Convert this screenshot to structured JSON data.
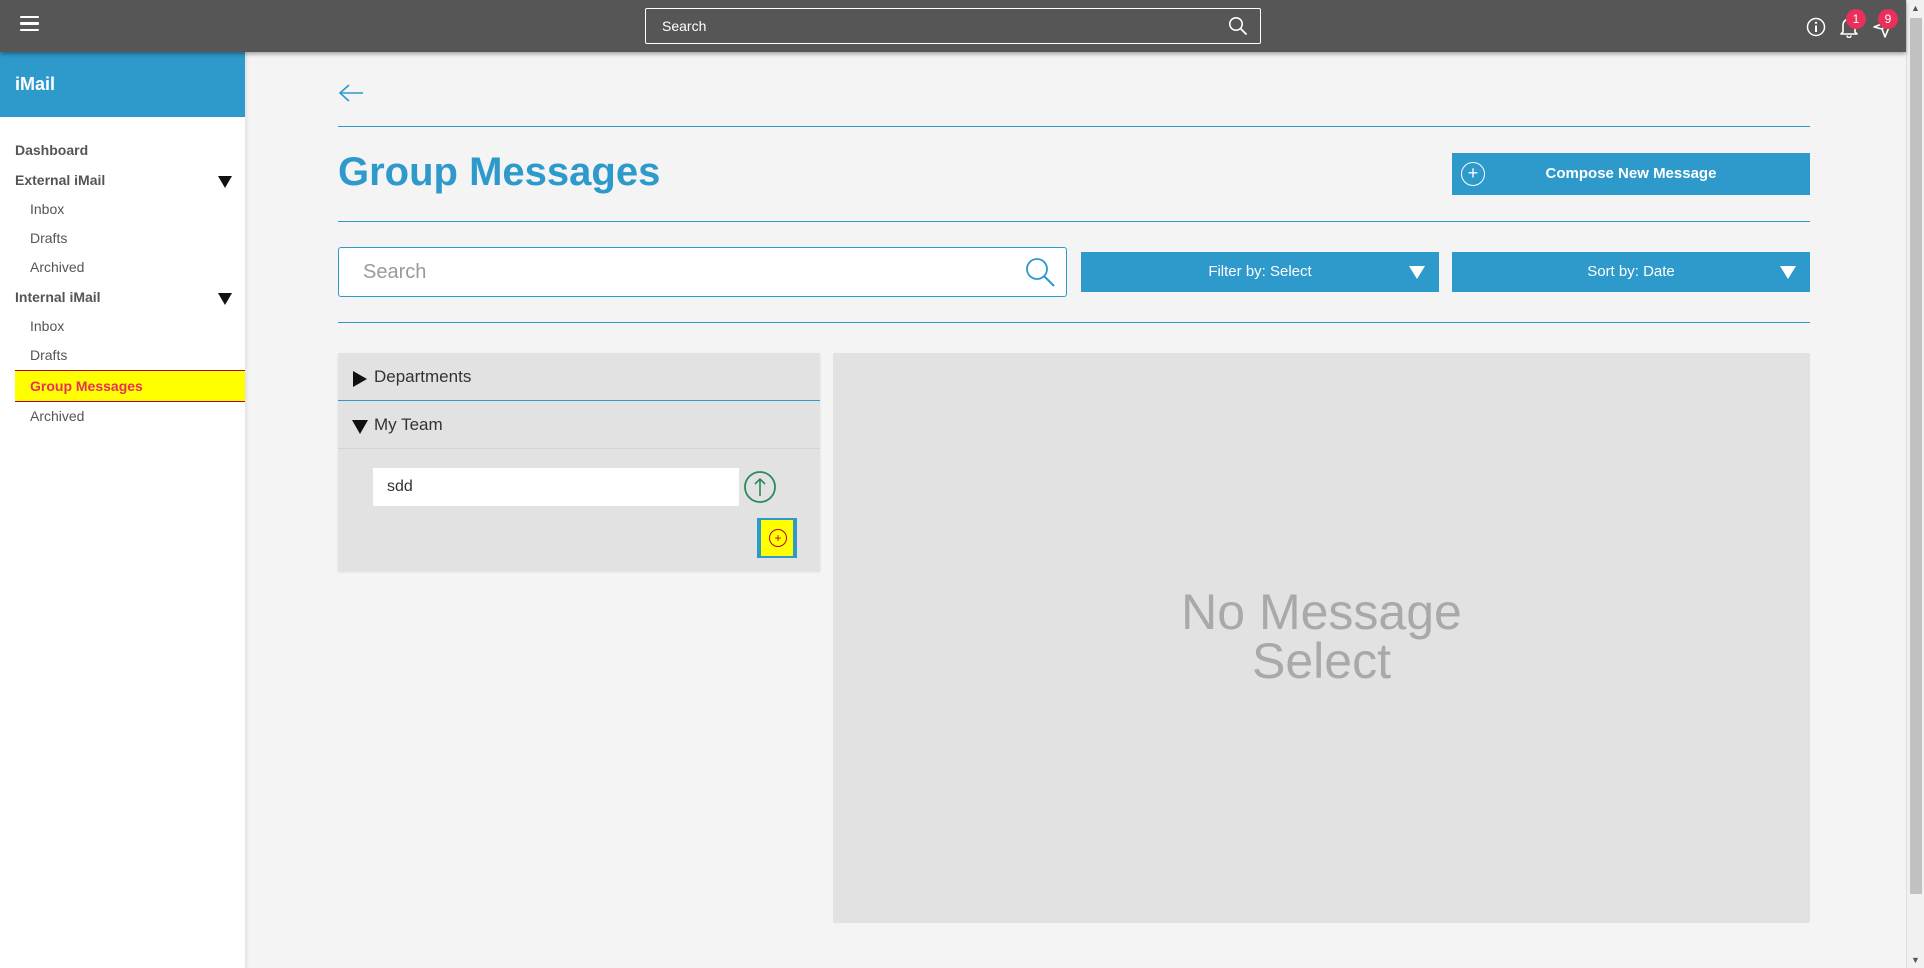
{
  "topbar": {
    "search_placeholder": "Search",
    "notifications_count": "1",
    "messages_count": "9"
  },
  "sidebar": {
    "app_title": "iMail",
    "dashboard": "Dashboard",
    "external": {
      "label": "External iMail",
      "items": [
        "Inbox",
        "Drafts",
        "Archived"
      ]
    },
    "internal": {
      "label": "Internal iMail",
      "items": [
        "Inbox",
        "Drafts",
        "Group Messages",
        "Archived"
      ],
      "active_index": 2
    }
  },
  "main": {
    "title": "Group Messages",
    "compose_label": "Compose New Message",
    "search_placeholder": "Search",
    "filter_label": "Filter by: Select",
    "sort_label": "Sort by: Date",
    "groups": {
      "departments": "Departments",
      "my_team": "My Team",
      "team_input_value": "sdd"
    },
    "preview_empty_line1": "No Message",
    "preview_empty_line2": "Select"
  },
  "colors": {
    "accent": "#2e99cb",
    "topbar": "#565656",
    "highlight": "#ffff00",
    "badge": "#e8305a",
    "upload_icon": "#2a8a5a"
  }
}
